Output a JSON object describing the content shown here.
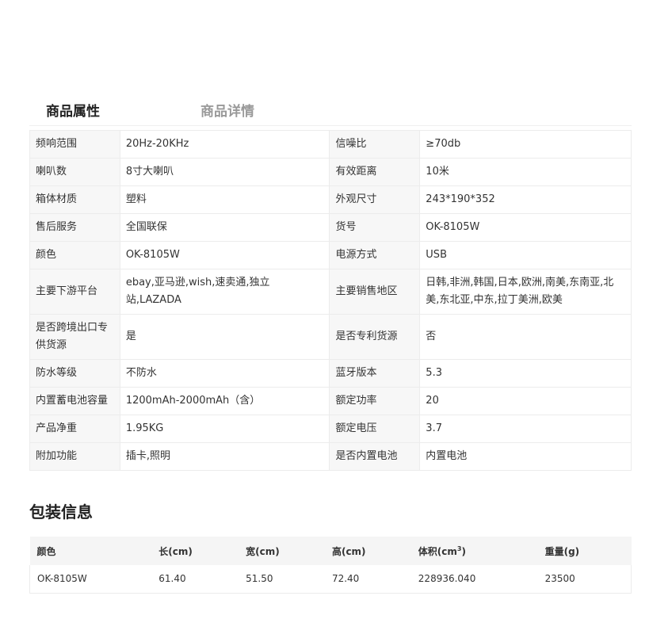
{
  "tabs": {
    "attributes": "商品属性",
    "details": "商品详情"
  },
  "attributes": [
    [
      "频响范围",
      "20Hz-20KHz",
      "信噪比",
      "≥70db"
    ],
    [
      "喇叭数",
      "8寸大喇叭",
      "有效距离",
      "10米"
    ],
    [
      "箱体材质",
      "塑料",
      "外观尺寸",
      "243*190*352"
    ],
    [
      "售后服务",
      "全国联保",
      "货号",
      "OK-8105W"
    ],
    [
      "颜色",
      "OK-8105W",
      "电源方式",
      "USB"
    ],
    [
      "主要下游平台",
      "ebay,亚马逊,wish,速卖通,独立站,LAZADA",
      "主要销售地区",
      "日韩,非洲,韩国,日本,欧洲,南美,东南亚,北美,东北亚,中东,拉丁美洲,欧美"
    ],
    [
      "是否跨境出口专供货源",
      "是",
      "是否专利货源",
      "否"
    ],
    [
      "防水等级",
      "不防水",
      "蓝牙版本",
      "5.3"
    ],
    [
      "内置蓄电池容量",
      "1200mAh-2000mAh（含）",
      "额定功率",
      "20"
    ],
    [
      "产品净重",
      "1.95KG",
      "额定电压",
      "3.7"
    ],
    [
      "附加功能",
      "插卡,照明",
      "是否内置电池",
      "内置电池"
    ]
  ],
  "package": {
    "title": "包装信息",
    "headers": {
      "color": "颜色",
      "length": "长(cm)",
      "width": "宽(cm)",
      "height": "高(cm)",
      "volume": "体积(cm",
      "volume_sup": "3",
      "volume_end": ")",
      "weight": "重量(g)"
    },
    "row": {
      "color": "OK-8105W",
      "length": "61.40",
      "width": "51.50",
      "height": "72.40",
      "volume": "228936.040",
      "weight": "23500"
    }
  }
}
